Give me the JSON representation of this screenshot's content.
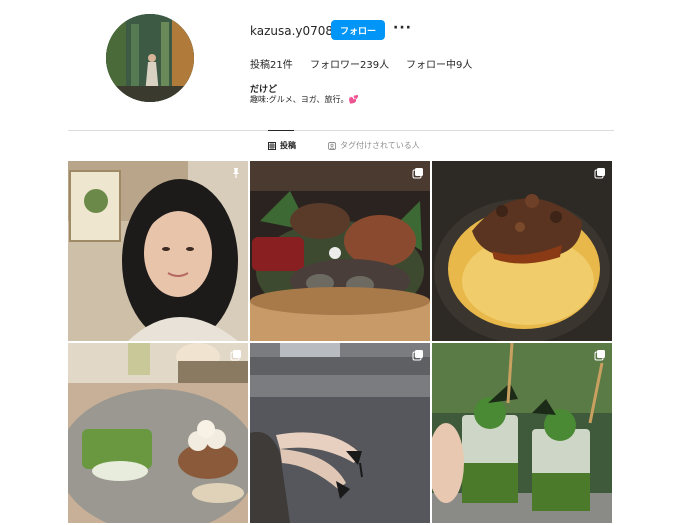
{
  "profile": {
    "username": "kazusa.y0708",
    "follow_label": "フォロー",
    "more_label": "···",
    "posts_label": "投稿21件",
    "followers_label": "フォロワー239人",
    "following_label": "フォロー中9人",
    "bio_name": "だけど",
    "bio_text": "趣味:グルメ、ヨガ、旅行。",
    "bio_emoji": "💕"
  },
  "tabs": [
    {
      "label": "投稿",
      "icon": "grid-icon",
      "active": true
    },
    {
      "label": "タグ付けされている人",
      "icon": "tag-person-icon",
      "active": false
    }
  ],
  "posts": [
    {
      "subject": "selfie-portrait",
      "badge": "pin-icon"
    },
    {
      "subject": "seafood-barrel-platter",
      "badge": "carousel-icon"
    },
    {
      "subject": "omurice-with-minced-meat",
      "badge": "carousel-icon"
    },
    {
      "subject": "matcha-dessert-plate",
      "badge": "carousel-icon"
    },
    {
      "subject": "legs-and-heels-on-carpet",
      "badge": "carousel-icon"
    },
    {
      "subject": "matcha-drinks",
      "badge": "carousel-icon"
    }
  ],
  "colors": {
    "accent": "#0095f6",
    "text": "#262626",
    "muted": "#8e8e8e",
    "divider": "#dbdbdb"
  }
}
